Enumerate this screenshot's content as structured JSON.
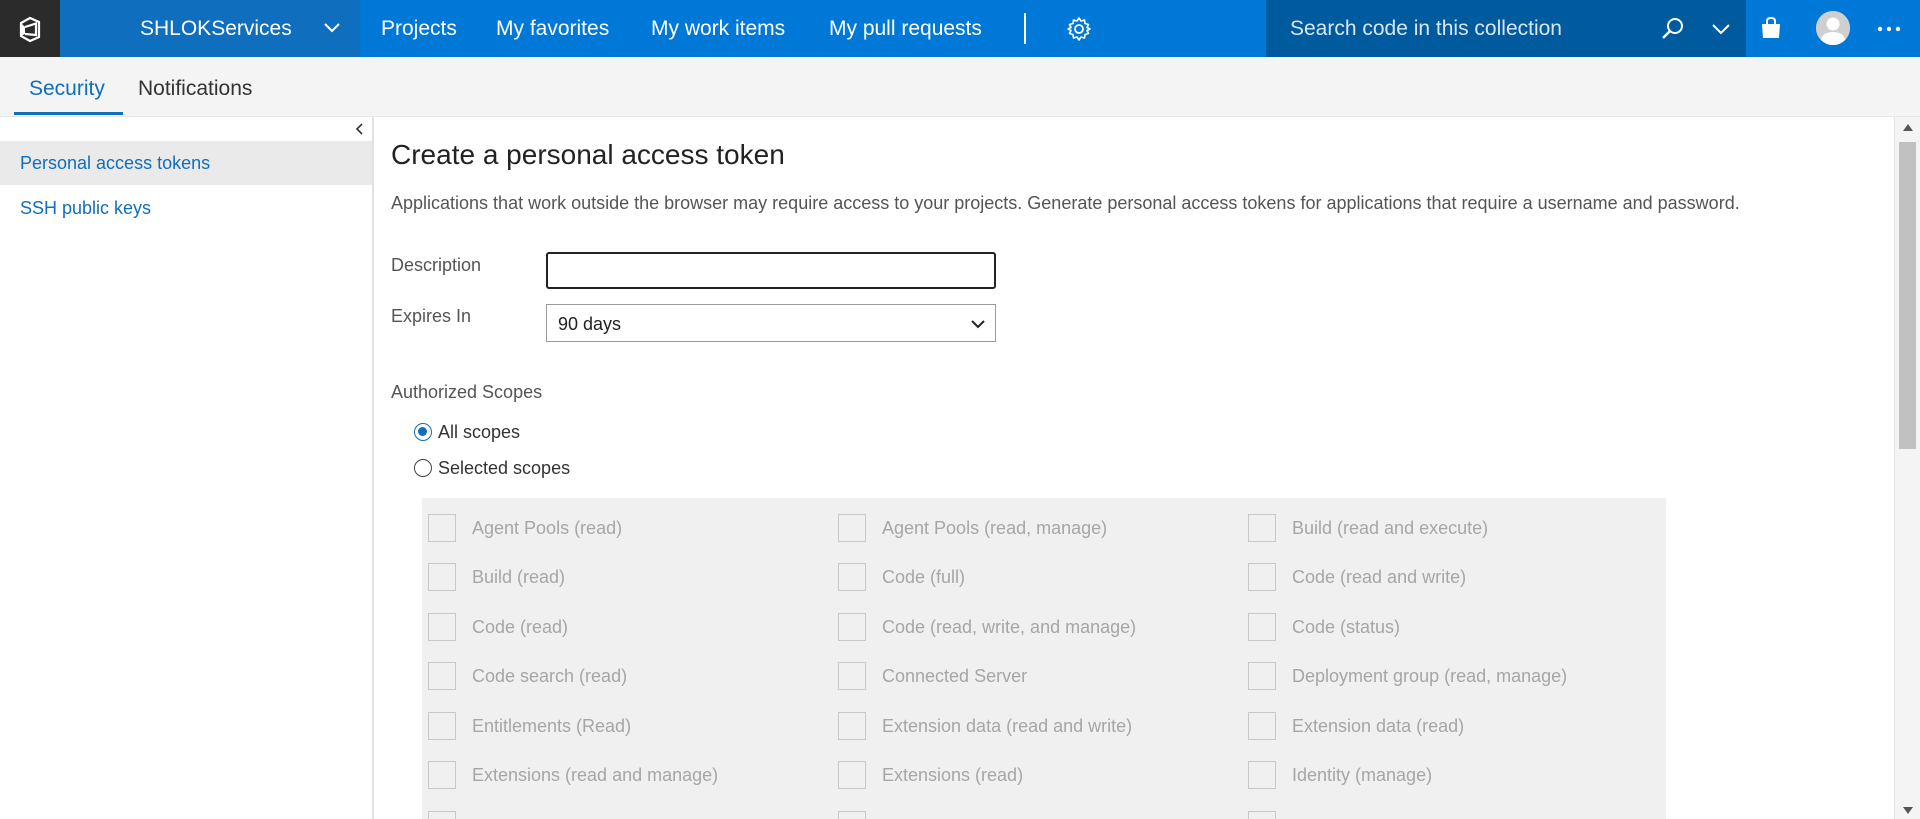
{
  "topbar": {
    "account_name": "SHLOKServices",
    "nav": [
      "Projects",
      "My favorites",
      "My work items",
      "My pull requests"
    ],
    "search_placeholder": "Search code in this collection"
  },
  "tabs": [
    "Security",
    "Notifications"
  ],
  "sidebar": {
    "items": [
      {
        "label": "Personal access tokens",
        "selected": true
      },
      {
        "label": "SSH public keys",
        "selected": false
      }
    ]
  },
  "main": {
    "title": "Create a personal access token",
    "description": "Applications that work outside the browser may require access to your projects. Generate personal access tokens for applications that require a username and password.",
    "description_label": "Description",
    "description_value": "",
    "expires_label": "Expires In",
    "expires_value": "90 days",
    "scopes_label": "Authorized Scopes",
    "radio_all": "All scopes",
    "radio_selected": "Selected scopes",
    "scopes": [
      "Agent Pools (read)",
      "Agent Pools (read, manage)",
      "Build (read and execute)",
      "Build (read)",
      "Code (full)",
      "Code (read and write)",
      "Code (read)",
      "Code (read, write, and manage)",
      "Code (status)",
      "Code search (read)",
      "Connected Server",
      "Deployment group (read, manage)",
      "Entitlements (Read)",
      "Extension data (read and write)",
      "Extension data (read)",
      "Extensions (read and manage)",
      "Extensions (read)",
      "Identity (manage)"
    ]
  },
  "colors": {
    "brand_blue": "#0078d7",
    "account_blue": "#106ebe",
    "search_blue": "#005a9e",
    "logo_dark": "#2b2b2b",
    "link_blue": "#106ebe"
  },
  "icons": [
    "vsts-logo-icon",
    "chevron-down-icon",
    "gear-icon",
    "search-icon",
    "shopping-bag-icon",
    "user-avatar-icon",
    "more-icon",
    "chevron-left-icon"
  ]
}
